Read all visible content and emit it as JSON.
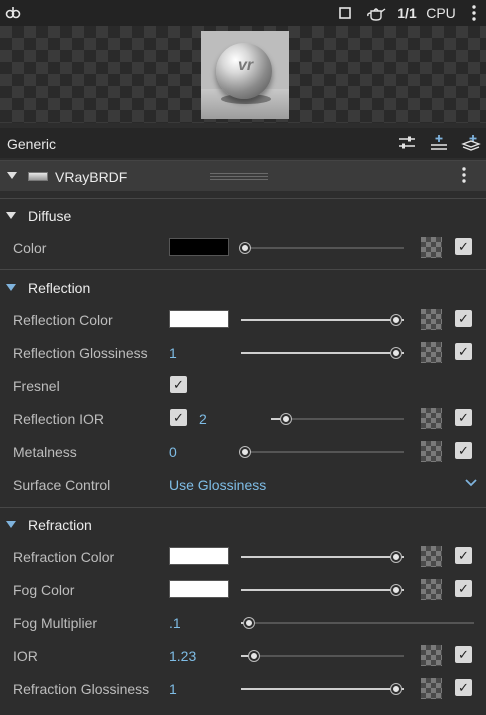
{
  "toolbar": {
    "link_icon": "link-icon",
    "stop_icon": "stop-icon",
    "teapot_icon": "teapot-icon",
    "ratio_label": "1/1",
    "device_label": "CPU",
    "menu_icon": "vertical-dots-icon"
  },
  "generic": {
    "title": "Generic",
    "icons": [
      "sliders-icon",
      "add-layer-icon",
      "add-stack-icon"
    ]
  },
  "material": {
    "name": "VRayBRDF"
  },
  "sections": {
    "diffuse": {
      "label": "Diffuse",
      "color_label": "Color"
    },
    "reflection": {
      "label": "Reflection",
      "reflection_color_label": "Reflection Color",
      "reflection_glossiness_label": "Reflection Glossiness",
      "reflection_glossiness_value": "1",
      "fresnel_label": "Fresnel",
      "reflection_ior_label": "Reflection IOR",
      "reflection_ior_value": "2",
      "metalness_label": "Metalness",
      "metalness_value": "0",
      "surface_control_label": "Surface Control",
      "surface_control_value": "Use Glossiness"
    },
    "refraction": {
      "label": "Refraction",
      "refraction_color_label": "Refraction Color",
      "fog_color_label": "Fog Color",
      "fog_multiplier_label": "Fog Multiplier",
      "fog_multiplier_value": ".1",
      "ior_label": "IOR",
      "ior_value": "1.23",
      "refraction_glossiness_label": "Refraction Glossiness",
      "refraction_glossiness_value": "1"
    }
  },
  "colors": {
    "accent": "#7fb3dd",
    "value_text": "#7fbde6",
    "panel_bg": "#2d2d2d"
  }
}
